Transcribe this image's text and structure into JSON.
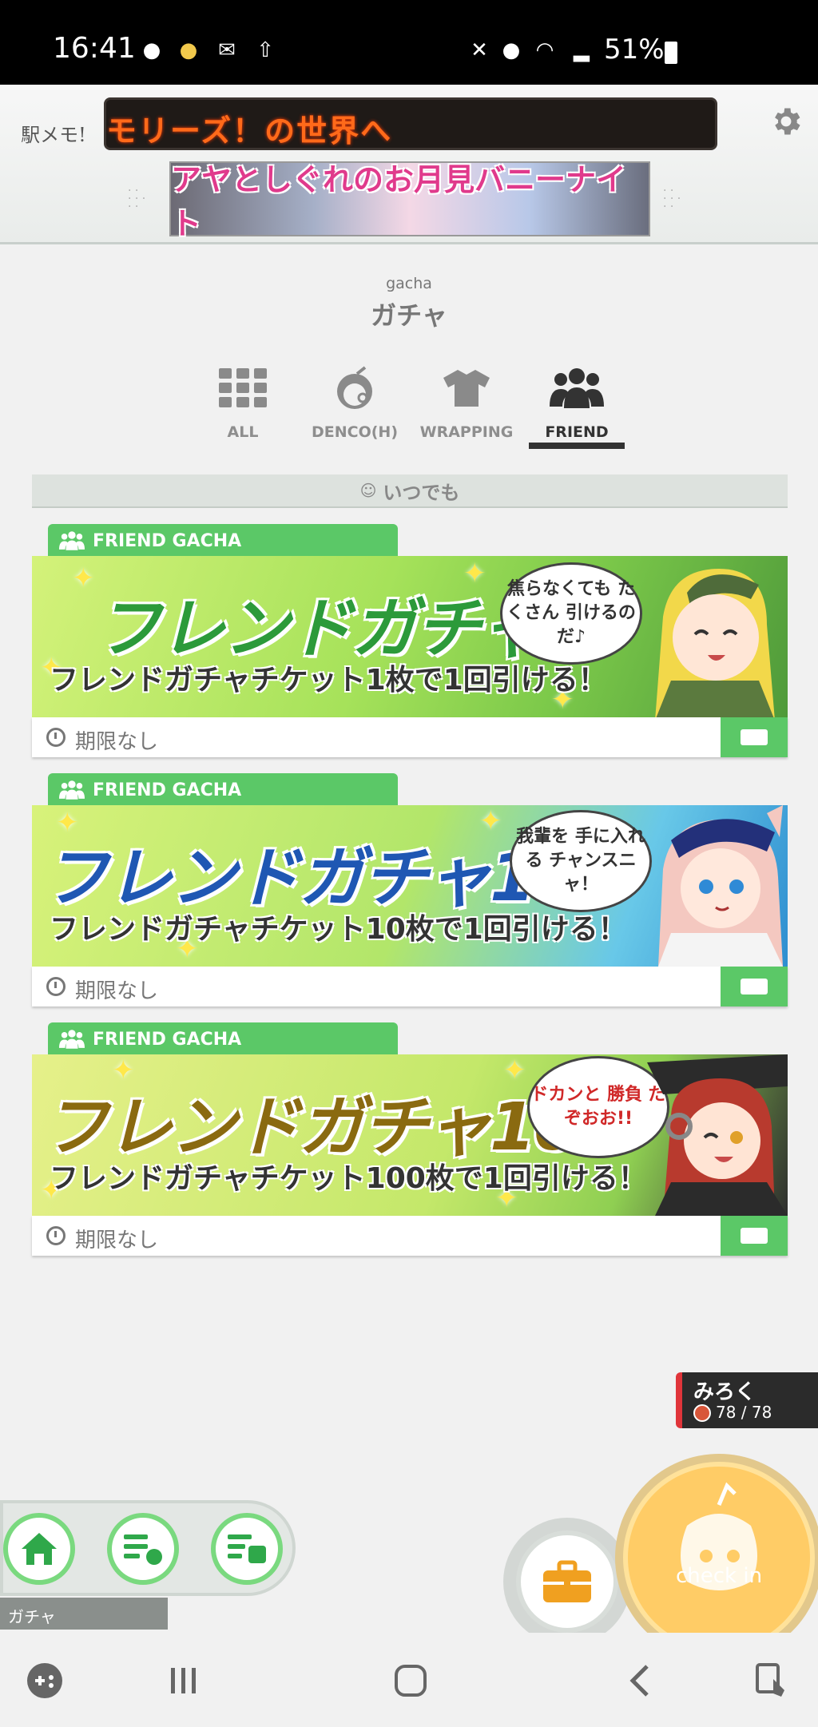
{
  "status_bar": {
    "time": "16:41",
    "battery": "51%"
  },
  "header": {
    "logo": "駅メモ!",
    "ticker": "モリーズ！の世界へ",
    "banner_title": "アヤとしぐれのお月見バニーナイト"
  },
  "page": {
    "subtitle": "gacha",
    "title": "ガチャ"
  },
  "tabs": [
    {
      "label": "ALL",
      "icon": "grid-icon",
      "active": false
    },
    {
      "label": "DENCO(H)",
      "icon": "denco-face-icon",
      "active": false
    },
    {
      "label": "WRAPPING",
      "icon": "shirt-icon",
      "active": false
    },
    {
      "label": "FRIEND",
      "icon": "friends-icon",
      "active": true
    }
  ],
  "section": {
    "label": "いつでも"
  },
  "cards": [
    {
      "tag": "FRIEND GACHA",
      "title": "フレンドガチャ",
      "subtitle": "フレンドガチャチケット1枚で1回引ける！",
      "speech": "焦らなくても たくさん 引けるのだ♪",
      "expiry": "期限なし",
      "title_color": "#2c9a3a"
    },
    {
      "tag": "FRIEND GACHA",
      "title": "フレンドガチャ10",
      "subtitle": "フレンドガチャチケット10枚で1回引ける！",
      "speech": "我輩を 手に入れる チャンスニャ！",
      "expiry": "期限なし",
      "title_color": "#1f57b3"
    },
    {
      "tag": "FRIEND GACHA",
      "title": "フレンドガチャ100",
      "subtitle": "フレンドガチャチケット100枚で1回引ける！",
      "speech": "ドカンと 勝負 だぞおお!!",
      "expiry": "期限なし",
      "title_color": "#8a6a10"
    }
  ],
  "player": {
    "name": "みろく",
    "hp": "78 / 78"
  },
  "nav": {
    "current_label": "ガチャ"
  },
  "checkin": {
    "label": "check in"
  }
}
